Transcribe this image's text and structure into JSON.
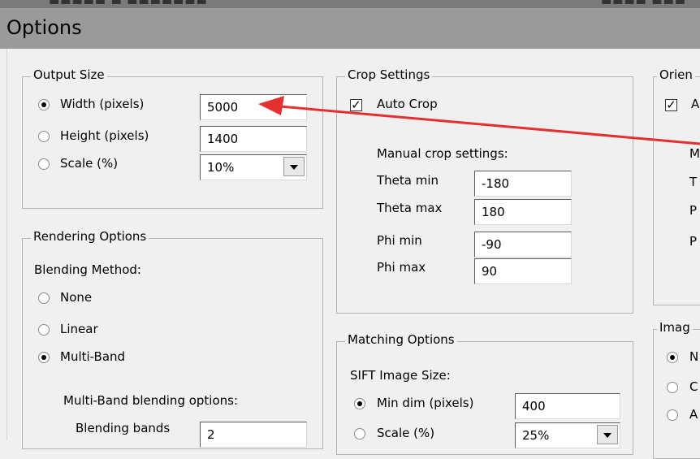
{
  "window": {
    "title": "Options"
  },
  "output_size": {
    "legend": "Output Size",
    "width_label": "Width (pixels)",
    "height_label": "Height (pixels)",
    "scale_label": "Scale (%)",
    "width_value": "5000",
    "height_value": "1400",
    "scale_value": "10%",
    "selected": "width"
  },
  "crop": {
    "legend": "Crop Settings",
    "auto_crop_label": "Auto Crop",
    "auto_crop_checked": true,
    "manual_label": "Manual crop settings:",
    "theta_min_label": "Theta min",
    "theta_min_value": "-180",
    "theta_max_label": "Theta max",
    "theta_max_value": "180",
    "phi_min_label": "Phi min",
    "phi_min_value": "-90",
    "phi_max_label": "Phi max",
    "phi_max_value": "90"
  },
  "orientation": {
    "legend_partial": "Orien",
    "check_label_partial": "A",
    "row1": "M",
    "row2": "T",
    "row3": "P",
    "row4": "P"
  },
  "rendering": {
    "legend": "Rendering Options",
    "blending_method_label": "Blending Method:",
    "none_label": "None",
    "linear_label": "Linear",
    "multiband_label": "Multi-Band",
    "selected": "multi-band",
    "multiband_options_label": "Multi-Band blending options:",
    "bands_label": "Blending bands",
    "bands_value": "2"
  },
  "matching": {
    "legend": "Matching Options",
    "sift_label": "SIFT Image Size:",
    "min_dim_label": "Min dim (pixels)",
    "min_dim_value": "400",
    "scale_label": "Scale (%)",
    "scale_value": "25%",
    "selected": "min-dim"
  },
  "image": {
    "legend_partial": "Imag",
    "opt1": "N",
    "opt2": "C",
    "opt3": "A"
  },
  "annotation": {
    "arrow_color": "#e53030"
  }
}
